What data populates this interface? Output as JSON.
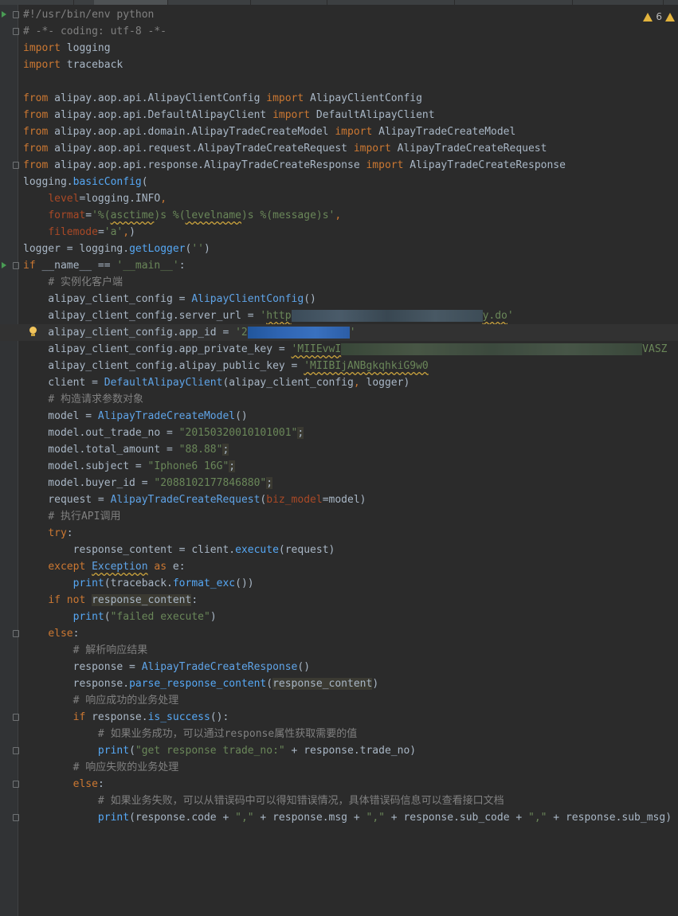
{
  "editor": {
    "warnings_count": "6",
    "lines": [
      {
        "segs": [
          [
            "cmt",
            "#!/usr/bin/env python"
          ]
        ],
        "fold": true,
        "run": true
      },
      {
        "segs": [
          [
            "cmt",
            "# -*- coding: utf-8 -*-"
          ]
        ],
        "fold": true
      },
      {
        "segs": [
          [
            "kw",
            "import"
          ],
          [
            "t",
            " logging"
          ]
        ]
      },
      {
        "segs": [
          [
            "kw",
            "import"
          ],
          [
            "t",
            " traceback"
          ]
        ]
      },
      {
        "segs": []
      },
      {
        "segs": [
          [
            "kw",
            "from"
          ],
          [
            "t",
            " alipay.aop.api.AlipayClientConfig "
          ],
          [
            "kw",
            "import"
          ],
          [
            "t",
            " AlipayClientConfig"
          ]
        ]
      },
      {
        "segs": [
          [
            "kw",
            "from"
          ],
          [
            "t",
            " alipay.aop.api.DefaultAlipayClient "
          ],
          [
            "kw",
            "import"
          ],
          [
            "t",
            " DefaultAlipayClient"
          ]
        ]
      },
      {
        "segs": [
          [
            "kw",
            "from"
          ],
          [
            "t",
            " alipay.aop.api.domain.AlipayTradeCreateModel "
          ],
          [
            "kw",
            "import"
          ],
          [
            "t",
            " AlipayTradeCreateModel"
          ]
        ]
      },
      {
        "segs": [
          [
            "kw",
            "from"
          ],
          [
            "t",
            " alipay.aop.api.request.AlipayTradeCreateRequest "
          ],
          [
            "kw",
            "import"
          ],
          [
            "t",
            " AlipayTradeCreateRequest"
          ]
        ]
      },
      {
        "segs": [
          [
            "kw",
            "from"
          ],
          [
            "t",
            " alipay.aop.api.response.AlipayTradeCreateResponse "
          ],
          [
            "kw",
            "import"
          ],
          [
            "t",
            " AlipayTradeCreateResponse"
          ]
        ],
        "fold": true
      },
      {
        "segs": [
          [
            "t",
            "logging."
          ],
          [
            "call",
            "basicConfig"
          ],
          [
            "t",
            "("
          ]
        ]
      },
      {
        "segs": [
          [
            "t",
            "    "
          ],
          [
            "param",
            "level"
          ],
          [
            "t",
            "=logging.INFO"
          ],
          [
            "kw",
            ","
          ]
        ]
      },
      {
        "segs": [
          [
            "t",
            "    "
          ],
          [
            "param",
            "format"
          ],
          [
            "t",
            "="
          ],
          [
            "str",
            "'%("
          ],
          [
            "str under",
            "asctime"
          ],
          [
            "str",
            ")s %("
          ],
          [
            "str under",
            "levelname"
          ],
          [
            "str",
            ")s %(message)s'"
          ],
          [
            "kw",
            ","
          ]
        ]
      },
      {
        "segs": [
          [
            "t",
            "    "
          ],
          [
            "param",
            "filemode"
          ],
          [
            "t",
            "="
          ],
          [
            "str",
            "'a'"
          ],
          [
            "kw",
            ","
          ],
          [
            "t",
            ")"
          ]
        ]
      },
      {
        "segs": [
          [
            "t",
            "logger = logging."
          ],
          [
            "call",
            "getLogger"
          ],
          [
            "t",
            "("
          ],
          [
            "str",
            "''"
          ],
          [
            "t",
            ")"
          ]
        ]
      },
      {
        "segs": [
          [
            "kw",
            "if"
          ],
          [
            "t",
            " __name__ == "
          ],
          [
            "str",
            "'__main__'"
          ],
          [
            "t",
            ":"
          ]
        ],
        "fold": true,
        "run": true
      },
      {
        "segs": [
          [
            "t",
            "    "
          ],
          [
            "cmt",
            "# 实例化客户端"
          ]
        ]
      },
      {
        "segs": [
          [
            "t",
            "    alipay_client_config = "
          ],
          [
            "cls",
            "AlipayClientConfig"
          ],
          [
            "t",
            "()"
          ]
        ]
      },
      {
        "segs": [
          [
            "t",
            "    alipay_client_config.server_url = "
          ],
          [
            "str",
            "'"
          ],
          [
            "str under",
            "http"
          ],
          [
            "blur",
            "",
            "240"
          ],
          [
            "str under",
            "y.do"
          ],
          [
            "str",
            "'"
          ]
        ]
      },
      {
        "segs": [
          [
            "t",
            "    alipay_client_config.app_id = "
          ],
          [
            "str",
            "'2"
          ],
          [
            "blurblue",
            "",
            "128"
          ],
          [
            "str",
            "'"
          ]
        ],
        "current": true,
        "bulb": true
      },
      {
        "segs": [
          [
            "t",
            "    alipay_client_config.app_private_key = "
          ],
          [
            "str under",
            "'MIIEvwI"
          ],
          [
            "blurgreen",
            "",
            "378"
          ],
          [
            "str",
            "VASZ"
          ]
        ]
      },
      {
        "segs": [
          [
            "t",
            "    alipay_client_config.alipay_public_key = "
          ],
          [
            "str under",
            "'MIIBIjANBgkqhkiG9w0"
          ]
        ]
      },
      {
        "segs": [
          [
            "t",
            "    client = "
          ],
          [
            "cls",
            "DefaultAlipayClient"
          ],
          [
            "t",
            "(alipay_client_config"
          ],
          [
            "kw",
            ","
          ],
          [
            "t",
            " logger)"
          ]
        ]
      },
      {
        "segs": [
          [
            "t",
            "    "
          ],
          [
            "cmt",
            "# 构造请求参数对象"
          ]
        ]
      },
      {
        "segs": [
          [
            "t",
            "    model = "
          ],
          [
            "cls",
            "AlipayTradeCreateModel"
          ],
          [
            "t",
            "()"
          ]
        ]
      },
      {
        "segs": [
          [
            "t",
            "    model.out_trade_no = "
          ],
          [
            "str",
            "\"20150320010101001\""
          ],
          [
            "hl",
            ";"
          ]
        ]
      },
      {
        "segs": [
          [
            "t",
            "    model.total_amount = "
          ],
          [
            "str",
            "\"88.88\""
          ],
          [
            "hl",
            ";"
          ]
        ]
      },
      {
        "segs": [
          [
            "t",
            "    model.subject = "
          ],
          [
            "str",
            "\"Iphone6 16G\""
          ],
          [
            "hl",
            ";"
          ]
        ]
      },
      {
        "segs": [
          [
            "t",
            "    model.buyer_id = "
          ],
          [
            "str",
            "\"2088102177846880\""
          ],
          [
            "hl",
            ";"
          ]
        ]
      },
      {
        "segs": [
          [
            "t",
            "    request = "
          ],
          [
            "cls",
            "AlipayTradeCreateRequest"
          ],
          [
            "t",
            "("
          ],
          [
            "param",
            "biz_model"
          ],
          [
            "t",
            "=model)"
          ]
        ]
      },
      {
        "segs": [
          [
            "t",
            "    "
          ],
          [
            "cmt",
            "# 执行API调用"
          ]
        ]
      },
      {
        "segs": [
          [
            "t",
            "    "
          ],
          [
            "kw",
            "try"
          ],
          [
            "t",
            ":"
          ]
        ]
      },
      {
        "segs": [
          [
            "t",
            "        response_content = client."
          ],
          [
            "call",
            "execute"
          ],
          [
            "t",
            "(request)"
          ]
        ]
      },
      {
        "segs": [
          [
            "t",
            "    "
          ],
          [
            "kw",
            "except"
          ],
          [
            "t",
            " "
          ],
          [
            "cls under",
            "Exception"
          ],
          [
            "t",
            " "
          ],
          [
            "kw",
            "as"
          ],
          [
            "t",
            " e:"
          ]
        ]
      },
      {
        "segs": [
          [
            "t",
            "        "
          ],
          [
            "call",
            "print"
          ],
          [
            "t",
            "(traceback."
          ],
          [
            "call",
            "format_exc"
          ],
          [
            "t",
            "())"
          ]
        ]
      },
      {
        "segs": [
          [
            "t",
            "    "
          ],
          [
            "kw",
            "if not"
          ],
          [
            "t",
            " "
          ],
          [
            "hl",
            "response_content"
          ],
          [
            "t",
            ":"
          ]
        ]
      },
      {
        "segs": [
          [
            "t",
            "        "
          ],
          [
            "call",
            "print"
          ],
          [
            "t",
            "("
          ],
          [
            "str",
            "\"failed execute\""
          ],
          [
            "t",
            ")"
          ]
        ]
      },
      {
        "segs": [
          [
            "t",
            "    "
          ],
          [
            "kw",
            "else"
          ],
          [
            "t",
            ":"
          ]
        ],
        "fold": true
      },
      {
        "segs": [
          [
            "t",
            "        "
          ],
          [
            "cmt",
            "# 解析响应结果"
          ]
        ]
      },
      {
        "segs": [
          [
            "t",
            "        response = "
          ],
          [
            "cls",
            "AlipayTradeCreateResponse"
          ],
          [
            "t",
            "()"
          ]
        ]
      },
      {
        "segs": [
          [
            "t",
            "        response."
          ],
          [
            "call",
            "parse_response_content"
          ],
          [
            "t",
            "("
          ],
          [
            "hl",
            "response_content"
          ],
          [
            "t",
            ")"
          ]
        ]
      },
      {
        "segs": [
          [
            "t",
            "        "
          ],
          [
            "cmt",
            "# 响应成功的业务处理"
          ]
        ]
      },
      {
        "segs": [
          [
            "t",
            "        "
          ],
          [
            "kw",
            "if"
          ],
          [
            "t",
            " response."
          ],
          [
            "call",
            "is_success"
          ],
          [
            "t",
            "():"
          ]
        ],
        "fold": true
      },
      {
        "segs": [
          [
            "t",
            "            "
          ],
          [
            "cmt",
            "# 如果业务成功，可以通过response属性获取需要的值"
          ]
        ]
      },
      {
        "segs": [
          [
            "t",
            "            "
          ],
          [
            "call",
            "print"
          ],
          [
            "t",
            "("
          ],
          [
            "str",
            "\"get response trade_no:\""
          ],
          [
            "t",
            " + response.trade_no)"
          ]
        ],
        "fold": true
      },
      {
        "segs": [
          [
            "t",
            "        "
          ],
          [
            "cmt",
            "# 响应失败的业务处理"
          ]
        ]
      },
      {
        "segs": [
          [
            "t",
            "        "
          ],
          [
            "kw",
            "else"
          ],
          [
            "t",
            ":"
          ]
        ],
        "fold": true
      },
      {
        "segs": [
          [
            "t",
            "            "
          ],
          [
            "cmt",
            "# 如果业务失败，可以从错误码中可以得知错误情况，具体错误码信息可以查看接口文档"
          ]
        ]
      },
      {
        "segs": [
          [
            "t",
            "            "
          ],
          [
            "call",
            "print"
          ],
          [
            "t",
            "(response.code + "
          ],
          [
            "str",
            "\",\""
          ],
          [
            "t",
            " + response.msg + "
          ],
          [
            "str",
            "\",\""
          ],
          [
            "t",
            " + response.sub_code + "
          ],
          [
            "str",
            "\",\""
          ],
          [
            "t",
            " + response.sub_msg)"
          ]
        ],
        "fold": true
      }
    ]
  }
}
